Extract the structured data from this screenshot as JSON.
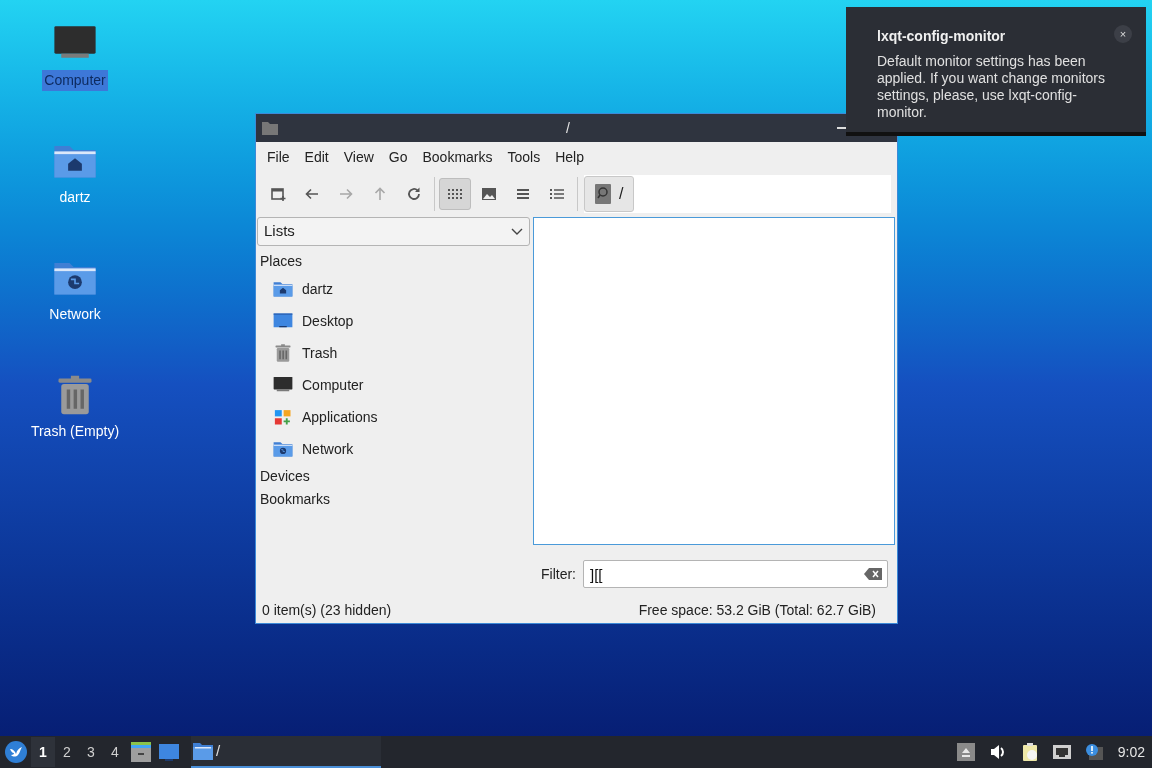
{
  "desktop_icons": [
    {
      "kind": "computer",
      "label": "Computer",
      "selected": true
    },
    {
      "kind": "home",
      "label": "dartz",
      "selected": false
    },
    {
      "kind": "network",
      "label": "Network",
      "selected": false
    },
    {
      "kind": "trash",
      "label": "Trash (Empty)",
      "selected": false
    }
  ],
  "window": {
    "title": "/",
    "menu": [
      "File",
      "Edit",
      "View",
      "Go",
      "Bookmarks",
      "Tools",
      "Help"
    ],
    "toolbar": [
      {
        "kind": "new-tab",
        "disabled": false,
        "selected": false
      },
      {
        "kind": "back",
        "disabled": false,
        "selected": false
      },
      {
        "kind": "forward",
        "disabled": true,
        "selected": false
      },
      {
        "kind": "up",
        "disabled": true,
        "selected": false
      },
      {
        "kind": "reload",
        "disabled": false,
        "selected": false
      },
      {
        "kind": "separator"
      },
      {
        "kind": "icon-view",
        "disabled": false,
        "selected": true
      },
      {
        "kind": "thumbnail-view",
        "disabled": false,
        "selected": false
      },
      {
        "kind": "compact-view",
        "disabled": false,
        "selected": false
      },
      {
        "kind": "detailed-view",
        "disabled": false,
        "selected": false
      },
      {
        "kind": "separator"
      }
    ],
    "path_bar": [
      {
        "label": "/",
        "selected": true
      }
    ],
    "side_pane": {
      "mode": "Lists",
      "sections": [
        {
          "label": "Places",
          "items": [
            {
              "kind": "home",
              "label": "dartz"
            },
            {
              "kind": "desktop",
              "label": "Desktop"
            },
            {
              "kind": "trash",
              "label": "Trash"
            },
            {
              "kind": "computer",
              "label": "Computer"
            },
            {
              "kind": "applications",
              "label": "Applications"
            },
            {
              "kind": "network",
              "label": "Network"
            }
          ]
        },
        {
          "label": "Devices"
        },
        {
          "label": "Bookmarks"
        }
      ]
    },
    "filter": {
      "label": "Filter:",
      "value": "][["
    },
    "status_bar": {
      "left": "0 item(s) (23 hidden)",
      "right": "Free space: 53.2 GiB (Total: 62.7 GiB)"
    }
  },
  "notification": {
    "title": "lxqt-config-monitor",
    "body": "Default monitor settings has been applied. If you want change monitors settings, please, use lxqt-config-monitor.",
    "close": "×"
  },
  "taskbar": {
    "workspaces": [
      {
        "label": "1",
        "selected": true
      },
      {
        "label": "2",
        "selected": false
      },
      {
        "label": "3",
        "selected": false
      },
      {
        "label": "4",
        "selected": false
      }
    ],
    "launchers": [
      {
        "kind": "file-cabinet"
      },
      {
        "kind": "desktop"
      }
    ],
    "tasks": [
      {
        "label": "/",
        "active": true
      }
    ],
    "tray": [
      {
        "kind": "eject"
      },
      {
        "kind": "volume"
      },
      {
        "kind": "clipboard"
      },
      {
        "kind": "network"
      },
      {
        "kind": "info"
      }
    ],
    "clock": "9:02"
  }
}
